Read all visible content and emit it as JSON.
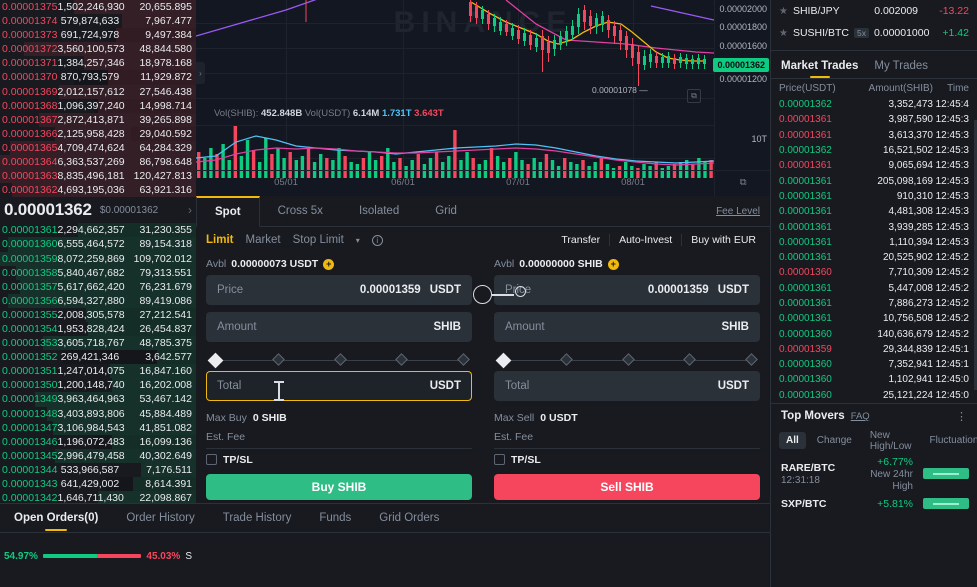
{
  "orderbook": {
    "asks": [
      {
        "price": "0.00001375",
        "amount": "1,502,246,930",
        "total": "20,655.895",
        "depth": 62,
        "dark": 0
      },
      {
        "price": "0.00001374",
        "amount": "579,874,633",
        "total": "7,967.477",
        "depth": 38,
        "dark": 0
      },
      {
        "price": "0.00001373",
        "amount": "691,724,978",
        "total": "9,497.384",
        "depth": 41,
        "dark": 44
      },
      {
        "price": "0.00001372",
        "amount": "3,560,100,573",
        "total": "48,844.580",
        "depth": 88,
        "dark": 0
      },
      {
        "price": "0.00001371",
        "amount": "1,384,257,346",
        "total": "18,978.168",
        "depth": 57,
        "dark": 0
      },
      {
        "price": "0.00001370",
        "amount": "870,793,579",
        "total": "11,929.872",
        "depth": 45,
        "dark": 62
      },
      {
        "price": "0.00001369",
        "amount": "2,012,157,612",
        "total": "27,546.438",
        "depth": 70,
        "dark": 0
      },
      {
        "price": "0.00001368",
        "amount": "1,096,397,240",
        "total": "14,998.714",
        "depth": 50,
        "dark": 52
      },
      {
        "price": "0.00001367",
        "amount": "2,872,413,871",
        "total": "39,265.898",
        "depth": 80,
        "dark": 0
      },
      {
        "price": "0.00001366",
        "amount": "2,125,958,428",
        "total": "29,040.592",
        "depth": 72,
        "dark": 33
      },
      {
        "price": "0.00001365",
        "amount": "4,709,474,624",
        "total": "64,284.329",
        "depth": 95,
        "dark": 0
      },
      {
        "price": "0.00001364",
        "amount": "6,363,537,269",
        "total": "86,798.648",
        "depth": 100,
        "dark": 0
      },
      {
        "price": "0.00001363",
        "amount": "8,835,496,181",
        "total": "120,427.813",
        "depth": 100,
        "dark": 0
      },
      {
        "price": "0.00001362",
        "amount": "4,693,195,036",
        "total": "63,921.316",
        "depth": 94,
        "dark": 0
      }
    ],
    "mid": {
      "price": "0.00001362",
      "fiat": "$0.00001362",
      "chevron": "›"
    },
    "bids": [
      {
        "price": "0.00001361",
        "amount": "2,294,662,357",
        "total": "31,230.355",
        "depth": 60,
        "dark": 60
      },
      {
        "price": "0.00001360",
        "amount": "6,555,464,572",
        "total": "89,154.318",
        "depth": 96,
        "dark": 0
      },
      {
        "price": "0.00001359",
        "amount": "8,072,259,869",
        "total": "109,702.012",
        "depth": 100,
        "dark": 0
      },
      {
        "price": "0.00001358",
        "amount": "5,840,467,682",
        "total": "79,313.551",
        "depth": 92,
        "dark": 0
      },
      {
        "price": "0.00001357",
        "amount": "5,617,662,420",
        "total": "76,231.679",
        "depth": 90,
        "dark": 0
      },
      {
        "price": "0.00001356",
        "amount": "6,594,327,880",
        "total": "89,419.086",
        "depth": 96,
        "dark": 0
      },
      {
        "price": "0.00001355",
        "amount": "2,008,305,578",
        "total": "27,212.541",
        "depth": 56,
        "dark": 42
      },
      {
        "price": "0.00001354",
        "amount": "1,953,828,424",
        "total": "26,454.837",
        "depth": 55,
        "dark": 42
      },
      {
        "price": "0.00001353",
        "amount": "3,605,718,767",
        "total": "48,785.375",
        "depth": 78,
        "dark": 0
      },
      {
        "price": "0.00001352",
        "amount": "269,421,346",
        "total": "3,642.577",
        "depth": 20,
        "dark": 68
      },
      {
        "price": "0.00001351",
        "amount": "1,247,014,075",
        "total": "16,847.160",
        "depth": 44,
        "dark": 0
      },
      {
        "price": "0.00001350",
        "amount": "1,200,148,740",
        "total": "16,202.008",
        "depth": 43,
        "dark": 0
      },
      {
        "price": "0.00001349",
        "amount": "3,963,464,963",
        "total": "53,467.142",
        "depth": 82,
        "dark": 0
      },
      {
        "price": "0.00001348",
        "amount": "3,403,893,806",
        "total": "45,884.489",
        "depth": 76,
        "dark": 0
      },
      {
        "price": "0.00001347",
        "amount": "3,106,984,543",
        "total": "41,851.082",
        "depth": 73,
        "dark": 0
      },
      {
        "price": "0.00001346",
        "amount": "1,196,072,483",
        "total": "16,099.136",
        "depth": 43,
        "dark": 52
      },
      {
        "price": "0.00001345",
        "amount": "2,996,479,458",
        "total": "40,302.649",
        "depth": 72,
        "dark": 0
      },
      {
        "price": "0.00001344",
        "amount": "533,966,587",
        "total": "7,176.511",
        "depth": 28,
        "dark": 0
      },
      {
        "price": "0.00001343",
        "amount": "641,429,002",
        "total": "8,614.391",
        "depth": 32,
        "dark": 46
      },
      {
        "price": "0.00001342",
        "amount": "1,646,711,430",
        "total": "22,098.867",
        "depth": 50,
        "dark": 0
      }
    ],
    "ratio": {
      "buy_pct": "54.97%",
      "sell_pct": "45.03%",
      "buy_value": 54.97,
      "sell_value": 45.03,
      "suffix": "S"
    }
  },
  "chart": {
    "watermark": "BINANCE",
    "volume_legend": {
      "label_shib": "Vol(SHIB):",
      "value_shib": "452.848B",
      "label_usdt": "Vol(USDT)",
      "value_usdt": "6.14M",
      "ma1": "1.731T",
      "ma2": "3.643T"
    },
    "x_labels": [
      "05/01",
      "06/01",
      "07/01",
      "08/01"
    ],
    "price_axis": [
      "0.00002000",
      "0.00001800",
      "0.00001600",
      "0.00001200"
    ],
    "current_price": "0.00001362",
    "volume_axis": "10T",
    "low_marker": "0.00001078 —",
    "collapse": "›",
    "axis_icon": "⧉"
  },
  "trade": {
    "tabs": [
      {
        "label": "Spot",
        "active": true
      },
      {
        "label": "Cross 5x",
        "active": false
      },
      {
        "label": "Isolated",
        "active": false
      },
      {
        "label": "Grid",
        "active": false
      }
    ],
    "fee_level": "Fee Level",
    "order_types": [
      {
        "label": "Limit",
        "active": true
      },
      {
        "label": "Market",
        "active": false
      },
      {
        "label": "Stop Limit",
        "active": false
      }
    ],
    "caret": "▾",
    "info": "i",
    "actions": [
      "Transfer",
      "Auto-Invest",
      "Buy with EUR"
    ],
    "buy": {
      "avbl_label": "Avbl",
      "avbl_value": "0.00000073 USDT",
      "price_label": "Price",
      "price_value": "0.00001359",
      "price_unit": "USDT",
      "amount_label": "Amount",
      "amount_unit": "SHIB",
      "total_label": "Total",
      "total_unit": "USDT",
      "max_label": "Max Buy",
      "max_value": "0 SHIB",
      "fee_label": "Est. Fee",
      "tpsl": "TP/SL",
      "button": "Buy SHIB"
    },
    "sell": {
      "avbl_label": "Avbl",
      "avbl_value": "0.00000000 SHIB",
      "price_label": "Price",
      "price_value": "0.00001359",
      "price_unit": "USDT",
      "amount_label": "Amount",
      "amount_unit": "SHIB",
      "total_label": "Total",
      "total_unit": "USDT",
      "max_label": "Max Sell",
      "max_value": "0 USDT",
      "fee_label": "Est. Fee",
      "tpsl": "TP/SL",
      "button": "Sell SHIB"
    }
  },
  "bottom_tabs": [
    {
      "label": "Open Orders(0)",
      "active": true
    },
    {
      "label": "Order History",
      "active": false
    },
    {
      "label": "Trade History",
      "active": false
    },
    {
      "label": "Funds",
      "active": false
    },
    {
      "label": "Grid Orders",
      "active": false
    }
  ],
  "sidebar": {
    "watchlist": [
      {
        "symbol": "SHIB/JPY",
        "leverage": "",
        "price": "0.002009",
        "change": "-13.22",
        "dir": "down"
      },
      {
        "symbol": "SUSHI/BTC",
        "leverage": "5x",
        "price": "0.00001000",
        "change": "+1.42",
        "dir": "up"
      }
    ],
    "trades": {
      "tabs": [
        {
          "label": "Market Trades",
          "active": true
        },
        {
          "label": "My Trades",
          "active": false
        }
      ],
      "columns": [
        "Price(USDT)",
        "Amount(SHIB)",
        "Time"
      ],
      "rows": [
        {
          "price": "0.00001362",
          "amount": "3,352,473",
          "time": "12:45:4",
          "dir": "up"
        },
        {
          "price": "0.00001361",
          "amount": "3,987,590",
          "time": "12:45:3",
          "dir": "down"
        },
        {
          "price": "0.00001361",
          "amount": "3,613,370",
          "time": "12:45:3",
          "dir": "down"
        },
        {
          "price": "0.00001362",
          "amount": "16,521,502",
          "time": "12:45:3",
          "dir": "up"
        },
        {
          "price": "0.00001361",
          "amount": "9,065,694",
          "time": "12:45:3",
          "dir": "down"
        },
        {
          "price": "0.00001361",
          "amount": "205,098,169",
          "time": "12:45:3",
          "dir": "up"
        },
        {
          "price": "0.00001361",
          "amount": "910,310",
          "time": "12:45:3",
          "dir": "up"
        },
        {
          "price": "0.00001361",
          "amount": "4,481,308",
          "time": "12:45:3",
          "dir": "up"
        },
        {
          "price": "0.00001361",
          "amount": "3,939,285",
          "time": "12:45:3",
          "dir": "up"
        },
        {
          "price": "0.00001361",
          "amount": "1,110,394",
          "time": "12:45:3",
          "dir": "up"
        },
        {
          "price": "0.00001361",
          "amount": "20,525,902",
          "time": "12:45:2",
          "dir": "up"
        },
        {
          "price": "0.00001360",
          "amount": "7,710,309",
          "time": "12:45:2",
          "dir": "down"
        },
        {
          "price": "0.00001361",
          "amount": "5,447,008",
          "time": "12:45:2",
          "dir": "up"
        },
        {
          "price": "0.00001361",
          "amount": "7,886,273",
          "time": "12:45:2",
          "dir": "up"
        },
        {
          "price": "0.00001361",
          "amount": "10,756,508",
          "time": "12:45:2",
          "dir": "up"
        },
        {
          "price": "0.00001360",
          "amount": "140,636,679",
          "time": "12:45:2",
          "dir": "up"
        },
        {
          "price": "0.00001359",
          "amount": "29,344,839",
          "time": "12:45:1",
          "dir": "down"
        },
        {
          "price": "0.00001360",
          "amount": "7,352,941",
          "time": "12:45:1",
          "dir": "up"
        },
        {
          "price": "0.00001360",
          "amount": "1,102,941",
          "time": "12:45:0",
          "dir": "up"
        },
        {
          "price": "0.00001360",
          "amount": "25,121,224",
          "time": "12:45:0",
          "dir": "up"
        }
      ]
    },
    "top_movers": {
      "title": "Top Movers",
      "faq": "FAQ",
      "dots": "⋮",
      "tabs": [
        {
          "label": "All",
          "active": true
        },
        {
          "label": "Change",
          "active": false
        },
        {
          "label": "New High/Low",
          "active": false
        },
        {
          "label": "Fluctuation",
          "active": false
        }
      ],
      "more": "›",
      "rows": [
        {
          "symbol": "RARE/BTC",
          "time": "12:31:18",
          "pct": "+6.77%",
          "note": "New 24hr High",
          "dir": "up"
        },
        {
          "symbol": "SXP/BTC",
          "time": "",
          "pct": "+5.81%",
          "note": "",
          "dir": "up"
        }
      ]
    }
  }
}
